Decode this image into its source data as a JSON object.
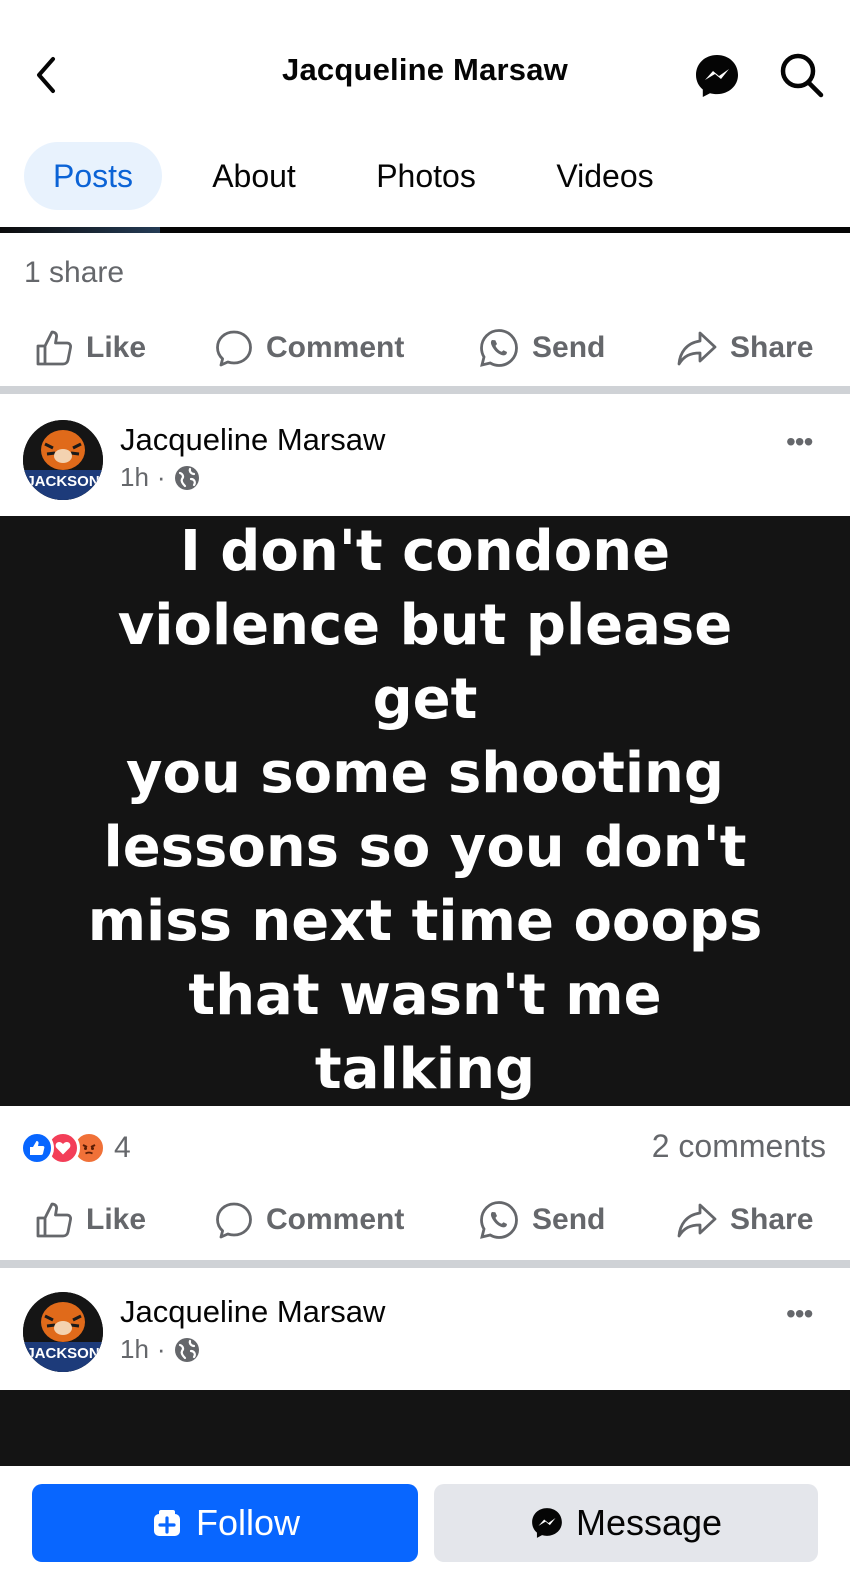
{
  "header": {
    "title": "Jacqueline Marsaw",
    "back_icon": "chevron-left-icon",
    "messenger_icon": "messenger-icon",
    "search_icon": "search-icon"
  },
  "tabs": [
    {
      "label": "Posts",
      "active": true
    },
    {
      "label": "About",
      "active": false
    },
    {
      "label": "Photos",
      "active": false
    },
    {
      "label": "Videos",
      "active": false
    }
  ],
  "previous_post": {
    "share_count": "1 share"
  },
  "actions": {
    "like": "Like",
    "comment": "Comment",
    "send": "Send",
    "share": "Share"
  },
  "post": {
    "author": "Jacqueline Marsaw",
    "time": "1h",
    "separator": "·",
    "privacy_icon": "globe-icon",
    "avatar_text": "JACKSON",
    "more": "•••",
    "image_text": "I don't condone\nviolence but please get\nyou some  shooting\nlessons so you don't\nmiss next time ooops\nthat wasn't me talking",
    "reaction_count": "4",
    "reaction_icons": [
      "like-reaction-icon",
      "love-reaction-icon",
      "angry-reaction-icon"
    ],
    "comments": "2 comments"
  },
  "next_post": {
    "author": "Jacqueline Marsaw",
    "time": "1h",
    "separator": "·",
    "more": "•••"
  },
  "bottom": {
    "follow": "Follow",
    "message": "Message"
  },
  "colors": {
    "brand_blue": "#0866ff",
    "active_tab_bg": "#e8f2fd",
    "active_tab_text": "#0b63d6",
    "secondary_text": "#65676b"
  }
}
